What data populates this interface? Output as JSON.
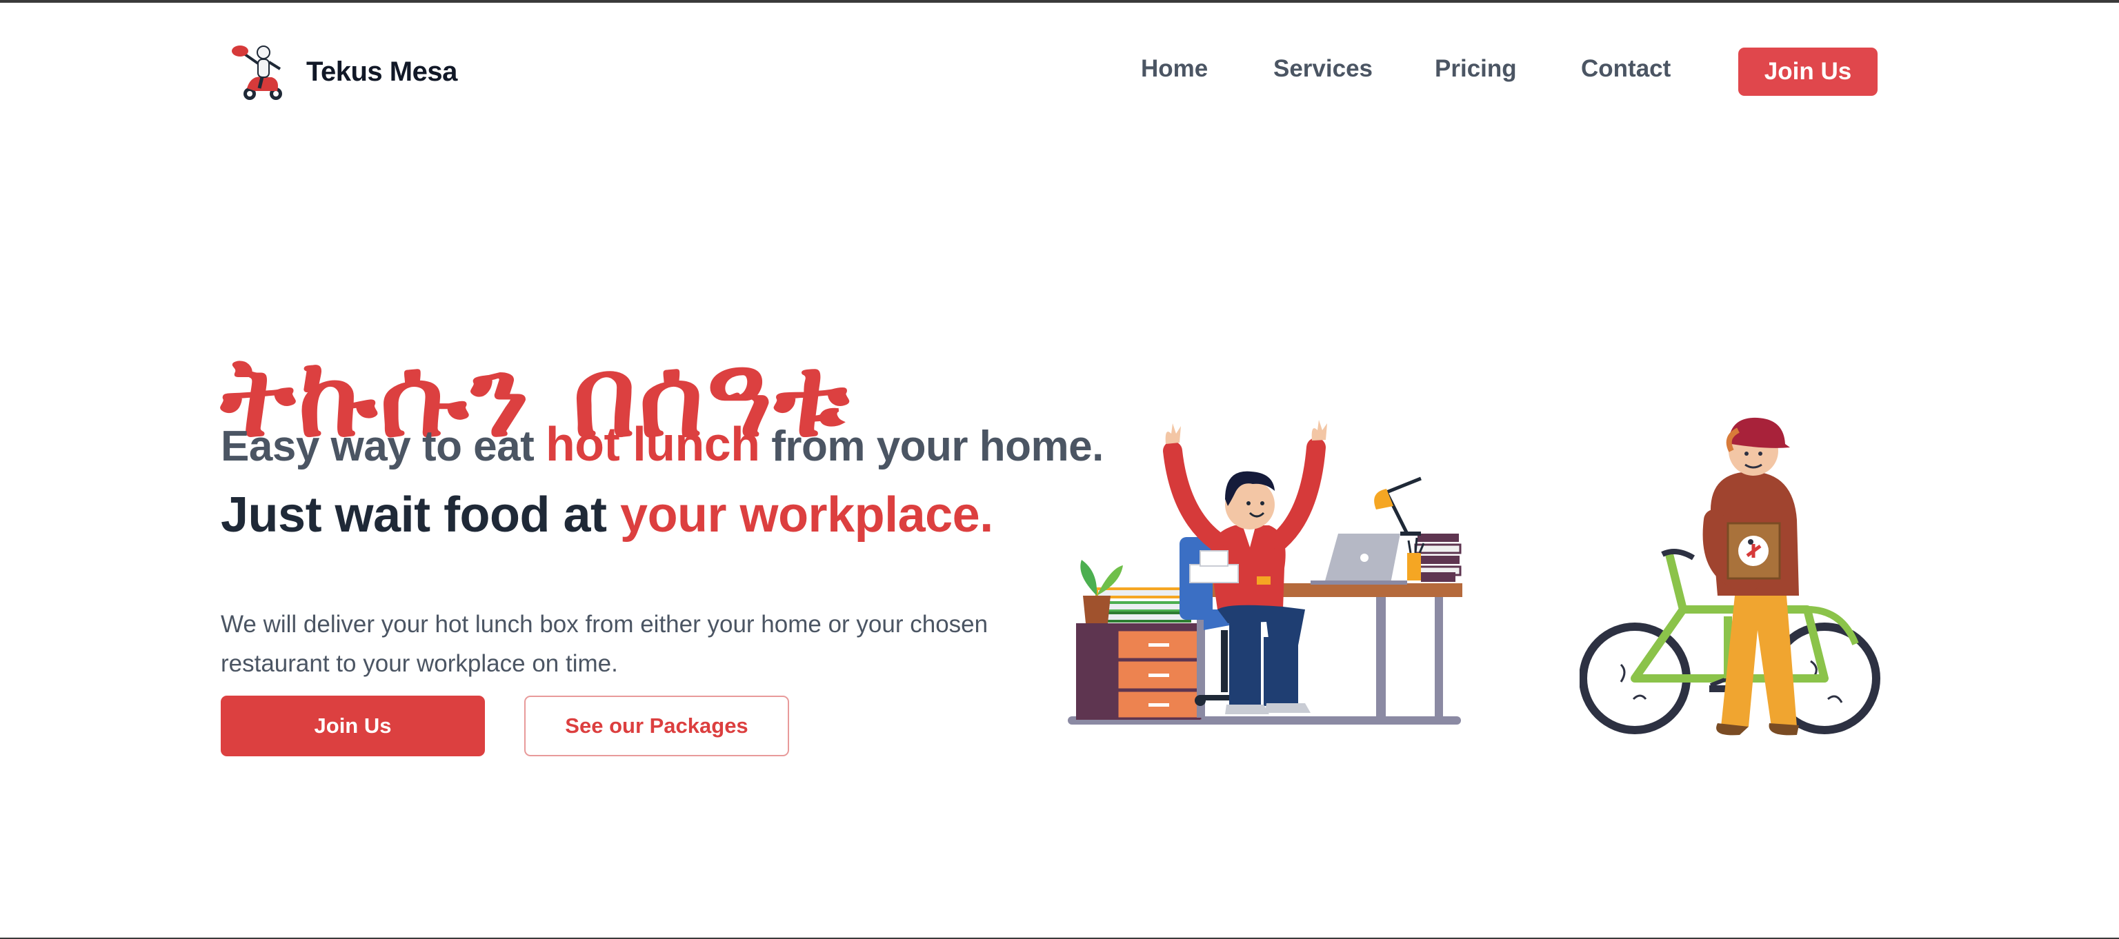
{
  "brand": {
    "name": "Tekus Mesa",
    "logo_icon": "delivery-scooter-icon"
  },
  "nav": {
    "links": [
      "Home",
      "Services",
      "Pricing",
      "Contact"
    ],
    "cta": "Join Us"
  },
  "hero": {
    "title": "ትኩሱን በሰዓቱ",
    "tagline1": {
      "pre": "Easy way to eat ",
      "highlight": "hot lunch",
      "post": " from your home."
    },
    "tagline2": {
      "pre": "Just wait food at ",
      "highlight": "your workplace."
    },
    "description": "We will deliver your hot lunch box from either your home or your chosen restaurant to your workplace on time.",
    "primary_button": "Join Us",
    "secondary_button": "See our Packages"
  },
  "illustrations": [
    "office-worker-at-desk",
    "delivery-person-with-bicycle"
  ],
  "colors": {
    "accent": "#dc4040",
    "text_dark": "#1f2937",
    "text_muted": "#4b5563"
  }
}
